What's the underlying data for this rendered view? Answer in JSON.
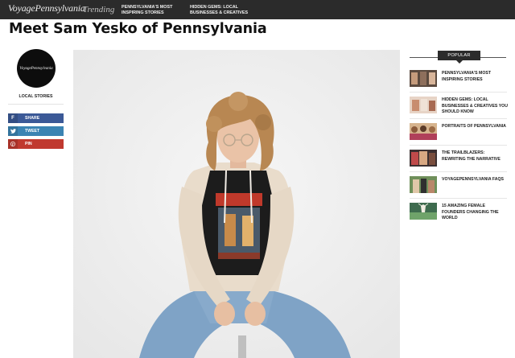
{
  "site": {
    "logo": "VoyagePennsylvania"
  },
  "topbar": {
    "trending_label": "Trending",
    "items": [
      {
        "label": "PENNSYLVANIA'S MOST INSPIRING STORIES"
      },
      {
        "label": "HIDDEN GEMS: LOCAL BUSINESSES & CREATIVES"
      }
    ]
  },
  "article": {
    "title": "Meet Sam Yesko of Pennsylvania",
    "category": "LOCAL STORIES"
  },
  "share": {
    "facebook": "SHARE",
    "twitter": "TWEET",
    "pinterest": "PIN"
  },
  "icons": {
    "facebook": "facebook-icon",
    "twitter": "twitter-icon",
    "pinterest": "pinterest-icon"
  },
  "colors": {
    "topbar": "#2b2b2b",
    "facebook": "#3b5997",
    "twitter": "#3b84b3",
    "pinterest": "#c0392f"
  },
  "sidebar": {
    "heading": "POPULAR",
    "items": [
      {
        "title": "PENNSYLVANIA'S MOST INSPIRING STORIES"
      },
      {
        "title": "HIDDEN GEMS: LOCAL BUSINESSES & CREATIVES YOU SHOULD KNOW"
      },
      {
        "title": "PORTRAITS OF PENNSYLVANIA"
      },
      {
        "title": "THE TRAILBLAZERS: REWRITING THE NARRATIVE"
      },
      {
        "title": "VOYAGEPENNSYLVANIA FAQS"
      },
      {
        "title": "15 AMAZING FEMALE FOUNDERS CHANGING THE WORLD"
      }
    ]
  }
}
